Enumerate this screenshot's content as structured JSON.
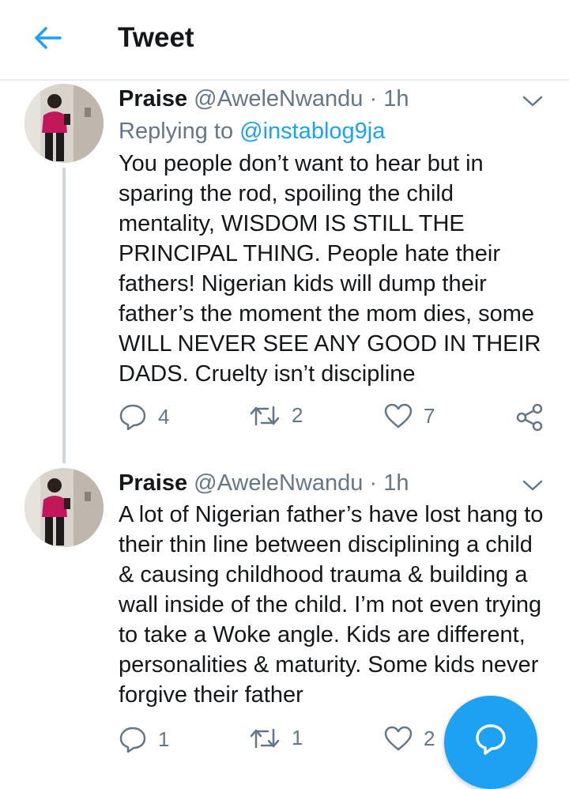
{
  "header": {
    "title": "Tweet",
    "back_icon": "arrow-left-icon",
    "accent": "#1da1f2"
  },
  "tweets": [
    {
      "name": "Praise",
      "handle": "@AweleNwandu",
      "separator": "·",
      "time": "1h",
      "replying_prefix": "Replying to",
      "replying_to": "@instablog9ja",
      "text": "You people don’t want to hear but in sparing the rod, spoiling the child mentality, WISDOM IS STILL THE PRINCIPAL THING. People hate their fathers! Nigerian kids will dump their father’s the moment the mom dies, some WILL NEVER SEE ANY GOOD IN THEIR DADS. Cruelty isn’t discipline",
      "replies": "4",
      "retweets": "2",
      "likes": "7"
    },
    {
      "name": "Praise",
      "handle": "@AweleNwandu",
      "separator": "·",
      "time": "1h",
      "text": "A lot of Nigerian father’s have lost hang to their thin line between disciplining a child & causing childhood trauma & building a wall inside of the child. I’m not even trying to take a Woke angle. Kids are different, personalities & maturity. Some kids never forgive their father",
      "replies": "1",
      "retweets": "1",
      "likes": "2"
    }
  ],
  "icons": [
    "arrow-left-icon",
    "chevron-down-icon",
    "reply-icon",
    "retweet-icon",
    "heart-icon",
    "share-icon",
    "compose-icon"
  ]
}
